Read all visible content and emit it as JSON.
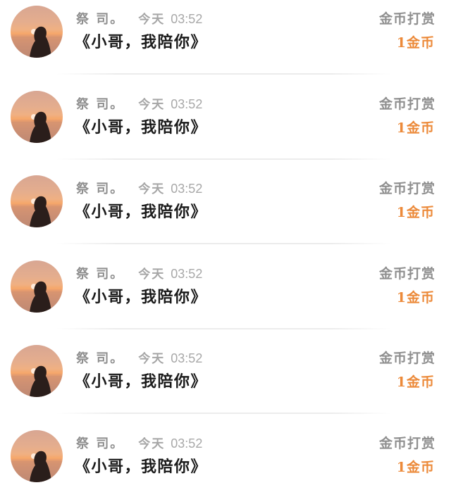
{
  "colors": {
    "accent": "#ec8a3a",
    "muted": "#8f8f8f",
    "text": "#1a1a1a"
  },
  "list": {
    "items": [
      {
        "name": "祭 司。",
        "date": "今天",
        "time": "03:52",
        "title": "《小哥，我陪你》",
        "reward_label": "金币打赏",
        "reward_amount": "1金币"
      },
      {
        "name": "祭 司。",
        "date": "今天",
        "time": "03:52",
        "title": "《小哥，我陪你》",
        "reward_label": "金币打赏",
        "reward_amount": "1金币"
      },
      {
        "name": "祭 司。",
        "date": "今天",
        "time": "03:52",
        "title": "《小哥，我陪你》",
        "reward_label": "金币打赏",
        "reward_amount": "1金币"
      },
      {
        "name": "祭 司。",
        "date": "今天",
        "time": "03:52",
        "title": "《小哥，我陪你》",
        "reward_label": "金币打赏",
        "reward_amount": "1金币"
      },
      {
        "name": "祭 司。",
        "date": "今天",
        "time": "03:52",
        "title": "《小哥，我陪你》",
        "reward_label": "金币打赏",
        "reward_amount": "1金币"
      },
      {
        "name": "祭 司。",
        "date": "今天",
        "time": "03:52",
        "title": "《小哥，我陪你》",
        "reward_label": "金币打赏",
        "reward_amount": "1金币"
      }
    ]
  }
}
